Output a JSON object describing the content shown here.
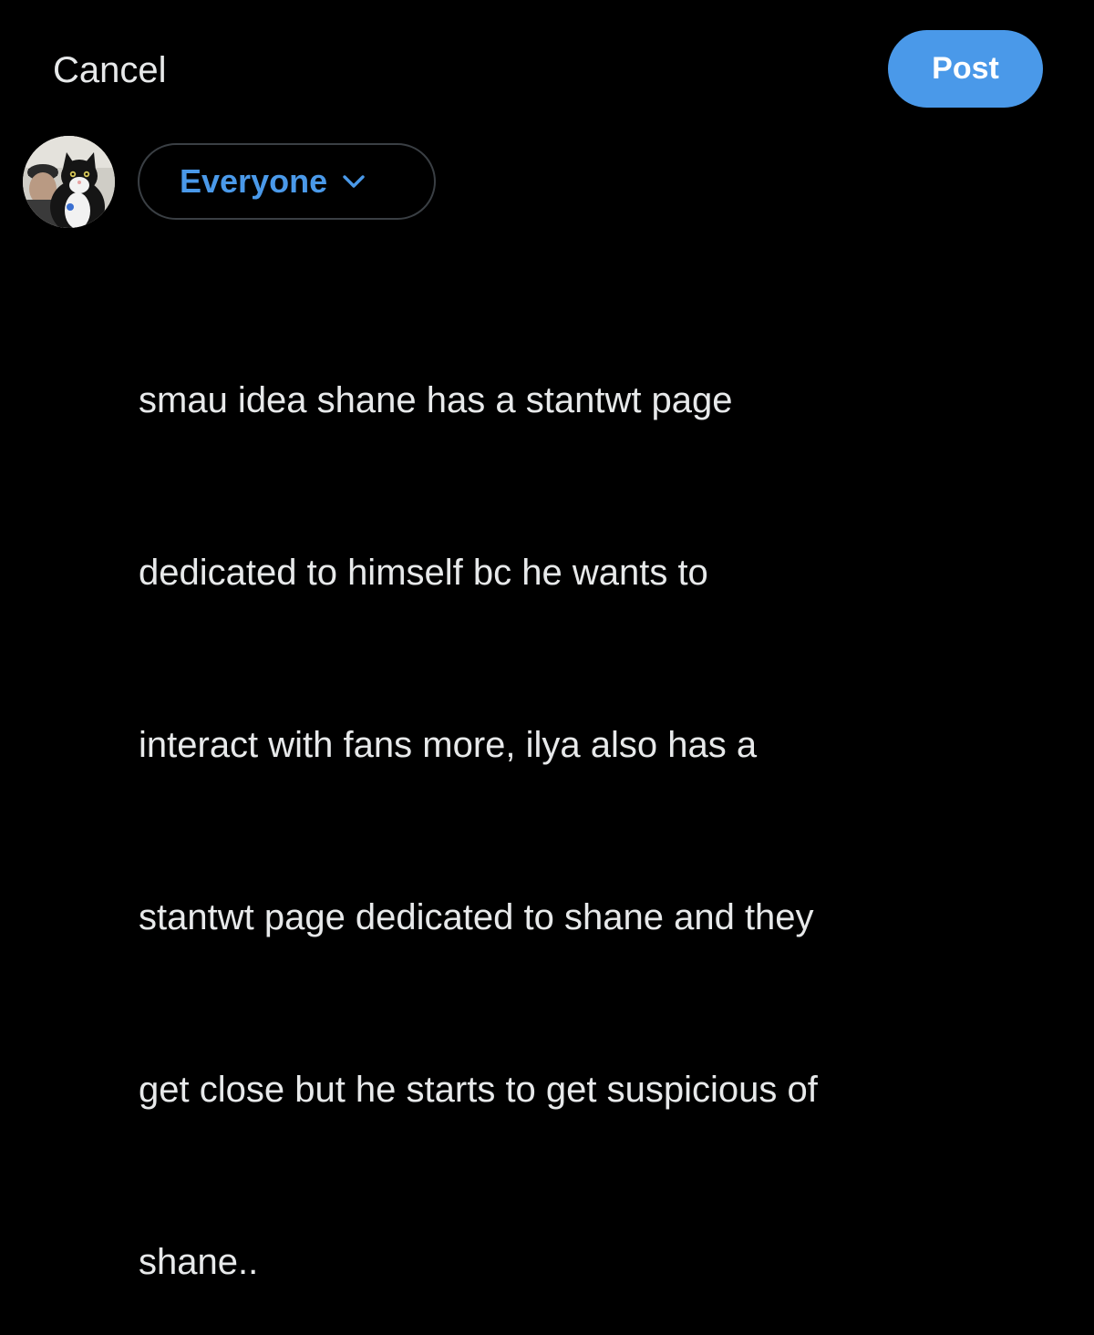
{
  "header": {
    "cancel_label": "Cancel",
    "post_label": "Post"
  },
  "composer": {
    "audience_label": "Everyone",
    "text_lines": [
      "smau idea shane has a stantwt page",
      "dedicated to himself bc he wants to",
      "interact with fans more, ilya also has a",
      "stantwt page dedicated to shane and they",
      "get close but he starts to get suspicious of",
      "shane.."
    ]
  },
  "colors": {
    "accent": "#4a99e9",
    "background": "#000000",
    "text": "#e7e9ea",
    "border": "#3a3f44"
  },
  "icons": {
    "audience_chevron": "chevron-down-icon",
    "avatar": "avatar-photo"
  }
}
